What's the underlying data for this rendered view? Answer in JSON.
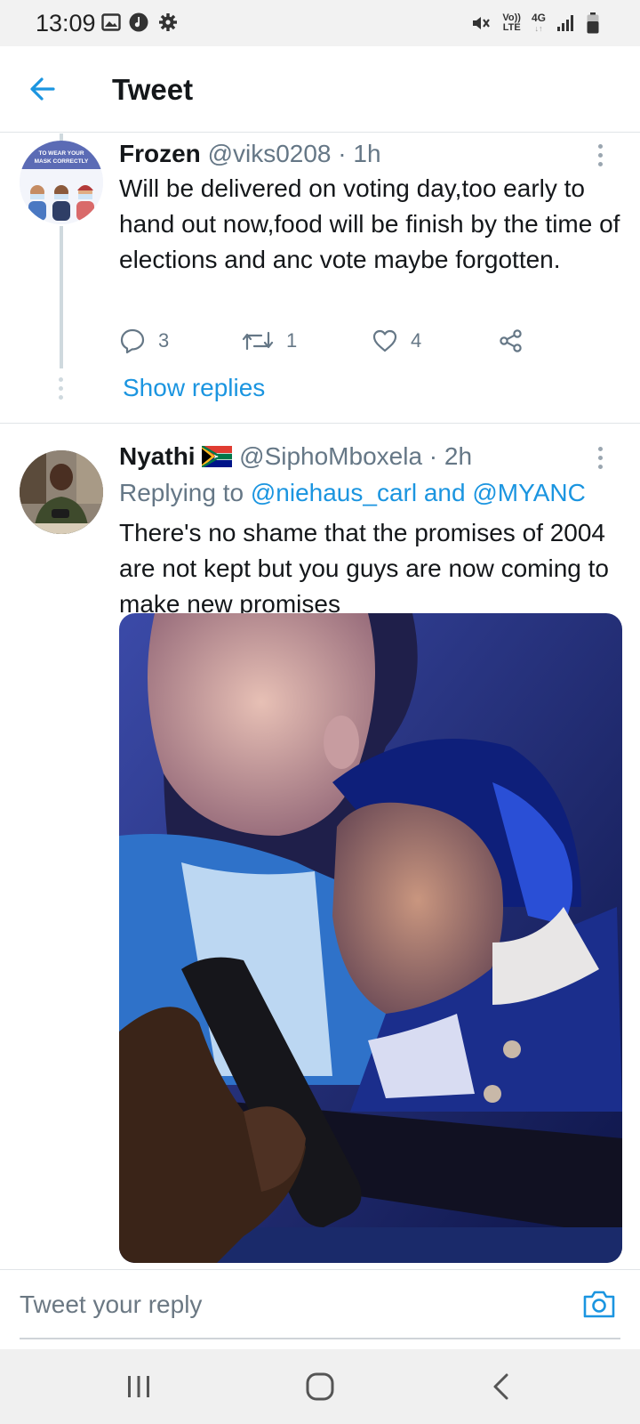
{
  "status_bar": {
    "time": "13:09",
    "left_icons": [
      "gallery-icon",
      "music-icon",
      "gear-icon"
    ],
    "right_icons": [
      "mute-icon",
      "volte-icon",
      "4g-icon",
      "signal-icon",
      "battery-icon"
    ],
    "volte_label_top": "Vo))",
    "volte_label_bottom": "LTE",
    "network_label": "4G"
  },
  "header": {
    "title": "Tweet",
    "back_icon": "arrow-left-icon"
  },
  "colors": {
    "accent": "#1b95e0",
    "text_primary": "#14171a",
    "text_secondary": "#657786",
    "divider": "#e1e5e8"
  },
  "tweets": [
    {
      "display_name": "Frozen",
      "handle": "@viks0208",
      "time": "1h",
      "text": "Will be delivered on voting day,too early to hand out now,food will be finish by the time of elections and anc vote maybe forgotten.",
      "avatar_banner": "TO WEAR YOUR MASK CORRECTLY",
      "actions": {
        "replies": "3",
        "retweets": "1",
        "likes": "4"
      },
      "show_replies": "Show replies"
    },
    {
      "display_name": "Nyathi",
      "flag": "🇿🇦",
      "handle": "@SiphoMboxela",
      "time": "2h",
      "reply_prefix": "Replying to",
      "reply_mentions": "@niehaus_carl and @MYANC",
      "text": "There's no shame that the promises of 2004 are not kept but you guys are now coming to make new promises"
    }
  ],
  "reply_bar": {
    "placeholder": "Tweet your reply",
    "camera_icon": "camera-icon"
  },
  "nav_bar": {
    "buttons": [
      "recents-icon",
      "home-icon",
      "back-icon"
    ]
  }
}
